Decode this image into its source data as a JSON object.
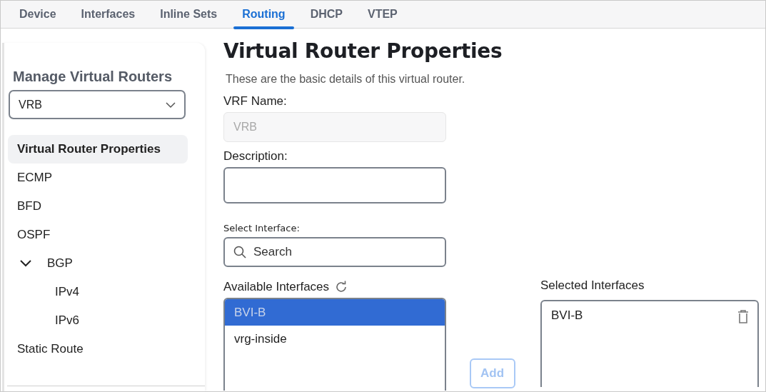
{
  "tabs": [
    {
      "label": "Device",
      "selected": false
    },
    {
      "label": "Interfaces",
      "selected": false
    },
    {
      "label": "Inline Sets",
      "selected": false
    },
    {
      "label": "Routing",
      "selected": true
    },
    {
      "label": "DHCP",
      "selected": false
    },
    {
      "label": "VTEP",
      "selected": false
    }
  ],
  "sidebar": {
    "heading": "Manage Virtual Routers",
    "router_select": {
      "value": "VRB"
    },
    "items": [
      {
        "label": "Virtual Router Properties",
        "selected": true
      },
      {
        "label": "ECMP",
        "selected": false
      },
      {
        "label": "BFD",
        "selected": false
      },
      {
        "label": "OSPF",
        "selected": false
      },
      {
        "label": "BGP",
        "selected": false,
        "expanded": true,
        "children": [
          {
            "label": "IPv4",
            "selected": false
          },
          {
            "label": "IPv6",
            "selected": false
          }
        ]
      },
      {
        "label": "Static Route",
        "selected": false
      }
    ]
  },
  "main": {
    "title": "Virtual Router Properties",
    "subtitle": "These are the basic details of this virtual router.",
    "vrf_name": {
      "label": "VRF Name:",
      "value": "VRB",
      "disabled": true
    },
    "description": {
      "label": "Description:"
    },
    "select_interface": {
      "label": "Select Interface:",
      "placeholder": "Search"
    },
    "available": {
      "label": "Available Interfaces",
      "items": [
        {
          "label": "BVI-B",
          "selected": true
        },
        {
          "label": "vrg-inside",
          "selected": false
        }
      ]
    },
    "add_button": {
      "label": "Add",
      "disabled": true
    },
    "selected": {
      "label": "Selected Interfaces",
      "items": [
        {
          "label": "BVI-B"
        }
      ]
    }
  }
}
